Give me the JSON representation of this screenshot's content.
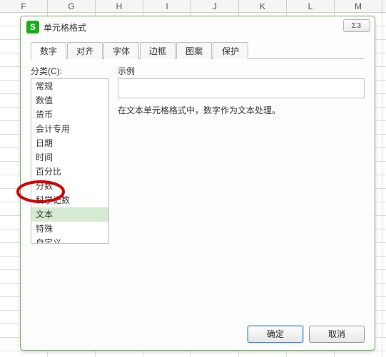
{
  "columns": [
    "F",
    "G",
    "H",
    "I",
    "J",
    "K",
    "L",
    "M"
  ],
  "dialog": {
    "title": "单元格格式",
    "app_icon_char": "S",
    "close_glyph": "ΣЗ",
    "tabs": [
      {
        "label": "数字",
        "active": true
      },
      {
        "label": "对齐",
        "active": false
      },
      {
        "label": "字体",
        "active": false
      },
      {
        "label": "边框",
        "active": false
      },
      {
        "label": "图案",
        "active": false
      },
      {
        "label": "保护",
        "active": false
      }
    ],
    "category_label": "分类(C):",
    "categories": [
      {
        "label": "常规",
        "selected": false
      },
      {
        "label": "数值",
        "selected": false
      },
      {
        "label": "货币",
        "selected": false
      },
      {
        "label": "会计专用",
        "selected": false
      },
      {
        "label": "日期",
        "selected": false
      },
      {
        "label": "时间",
        "selected": false
      },
      {
        "label": "百分比",
        "selected": false
      },
      {
        "label": "分数",
        "selected": false
      },
      {
        "label": "科学记数",
        "selected": false
      },
      {
        "label": "文本",
        "selected": true
      },
      {
        "label": "特殊",
        "selected": false
      },
      {
        "label": "自定义",
        "selected": false
      }
    ],
    "sample_label": "示例",
    "description": "在文本单元格格式中，数字作为文本处理。",
    "ok_label": "确定",
    "cancel_label": "取消"
  },
  "annotation": {
    "circle_color": "#d40000",
    "circle_stroke": 3
  }
}
